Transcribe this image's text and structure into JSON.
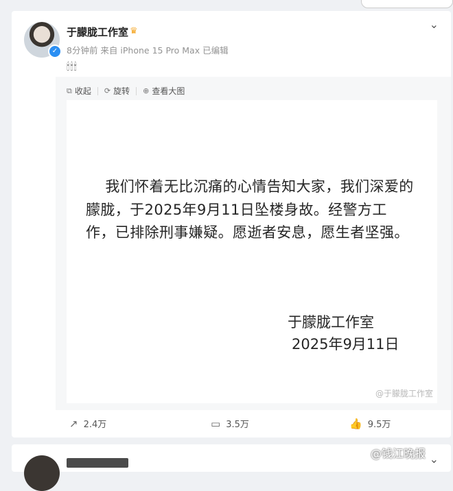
{
  "post": {
    "username": "于朦胧工作室",
    "meta": "8分钟前 来自 iPhone 15 Pro Max 已编辑",
    "emojis": "🕯🕯🕯",
    "tools": {
      "collapse": "收起",
      "rotate": "旋转",
      "view_large": "查看大图"
    },
    "image": {
      "statement": "    我们怀着无比沉痛的心情告知大家，我们深爱的朦胧，于2025年9月11日坠楼身故。经警方工作，已排除刑事嫌疑。愿逝者安息，愿生者坚强。",
      "signature_name": "于朦胧工作室",
      "signature_date": "2025年9月11日",
      "watermark": "@于朦胧工作室"
    },
    "actions": {
      "share": "2.4万",
      "comment": "3.5万",
      "like": "9.5万"
    }
  },
  "page_watermark": "@钱江晚报",
  "icons": {
    "verified": "verified-badge-icon",
    "crown": "crown-icon",
    "chevron": "chevron-down-icon",
    "share": "share-icon",
    "comment": "comment-icon",
    "like": "thumbs-up-icon"
  }
}
